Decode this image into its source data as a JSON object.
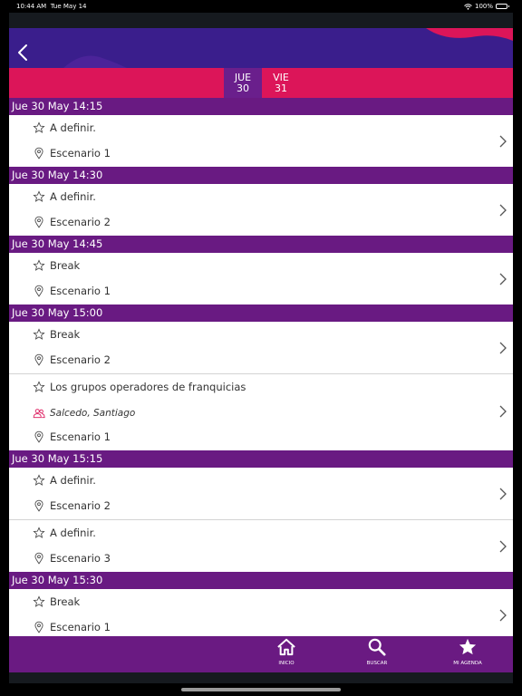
{
  "status_bar": {
    "time": "10:44 AM",
    "date": "Tue May 14",
    "battery": "100%"
  },
  "colors": {
    "header": "#3a1e8c",
    "accent": "#dc1559",
    "section": "#691a82",
    "tabbar": "#6a1a82"
  },
  "day_tabs": [
    {
      "day": "JUE",
      "num": "30",
      "active": true
    },
    {
      "day": "VIE",
      "num": "31",
      "active": false
    }
  ],
  "sections": [
    {
      "title": "Jue 30 May 14:15",
      "items": [
        {
          "title": "A definir.",
          "location": "Escenario 1"
        }
      ]
    },
    {
      "title": "Jue 30 May 14:30",
      "items": [
        {
          "title": "A definir.",
          "location": "Escenario 2"
        }
      ]
    },
    {
      "title": "Jue 30 May 14:45",
      "items": [
        {
          "title": "Break",
          "location": "Escenario 1"
        }
      ]
    },
    {
      "title": "Jue 30 May 15:00",
      "items": [
        {
          "title": "Break",
          "location": "Escenario 2"
        },
        {
          "title": "Los grupos operadores de franquicias",
          "speaker": "Salcedo, Santiago",
          "location": "Escenario 1"
        }
      ]
    },
    {
      "title": "Jue 30 May 15:15",
      "items": [
        {
          "title": "A definir.",
          "location": "Escenario 2"
        },
        {
          "title": "A definir.",
          "location": "Escenario 3"
        }
      ]
    },
    {
      "title": "Jue 30 May 15:30",
      "items": [
        {
          "title": "Break",
          "location": "Escenario 1"
        }
      ]
    }
  ],
  "tabbar": {
    "inicio": "INICIO",
    "buscar": "BUSCAR",
    "agenda": "MI AGENDA"
  }
}
